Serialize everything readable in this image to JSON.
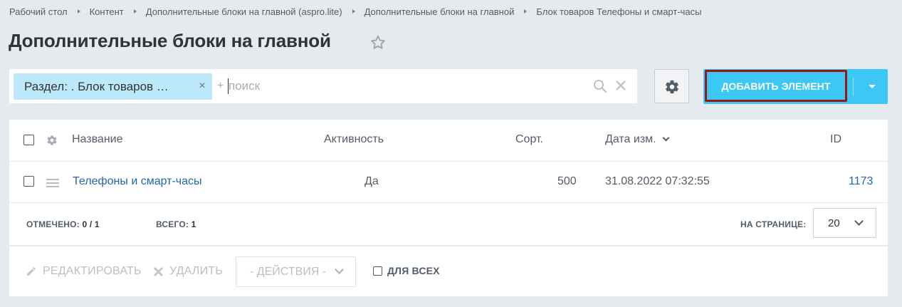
{
  "breadcrumb": [
    "Рабочий стол",
    "Контент",
    "Дополнительные блоки на главной (aspro.lite)",
    "Дополнительные блоки на главной",
    "Блок товаров Телефоны и смарт-часы"
  ],
  "page": {
    "title": "Дополнительные блоки на главной"
  },
  "filter": {
    "chip_label": "Раздел: . Блок товаров …",
    "chip_close": "×",
    "plus": "+",
    "search_placeholder": "поиск"
  },
  "toolbar": {
    "add_label": "ДОБАВИТЬ ЭЛЕМЕНТ"
  },
  "grid": {
    "columns": {
      "name": "Название",
      "active": "Активность",
      "sort": "Сорт.",
      "date": "Дата изм.",
      "id": "ID"
    },
    "rows": [
      {
        "name": "Телефоны и смарт-часы",
        "active": "Да",
        "sort": "500",
        "date": "31.08.2022 07:32:55",
        "id": "1173"
      }
    ],
    "footer": {
      "selected_label": "ОТМЕЧЕНО:",
      "selected_value": "0 / 1",
      "total_label": "ВСЕГО:",
      "total_value": "1",
      "per_page_label": "НА СТРАНИЦЕ:",
      "per_page_value": "20"
    },
    "actions": {
      "edit_label": "РЕДАКТИРОВАТЬ",
      "delete_label": "УДАЛИТЬ",
      "actions_placeholder": "- ДЕЙСТВИЯ -",
      "for_all_label": "ДЛЯ ВСЕХ"
    }
  },
  "colors": {
    "page_bg": "#e4eaed",
    "accent": "#3bc8f5",
    "chip_bg": "#bce8f9",
    "link": "#2067b0",
    "highlight_border": "#a01418"
  },
  "icons": [
    "star-icon",
    "search-icon",
    "clear-icon",
    "gear-icon",
    "chevron-down-icon",
    "drag-handle-icon",
    "pencil-icon",
    "cross-icon"
  ]
}
